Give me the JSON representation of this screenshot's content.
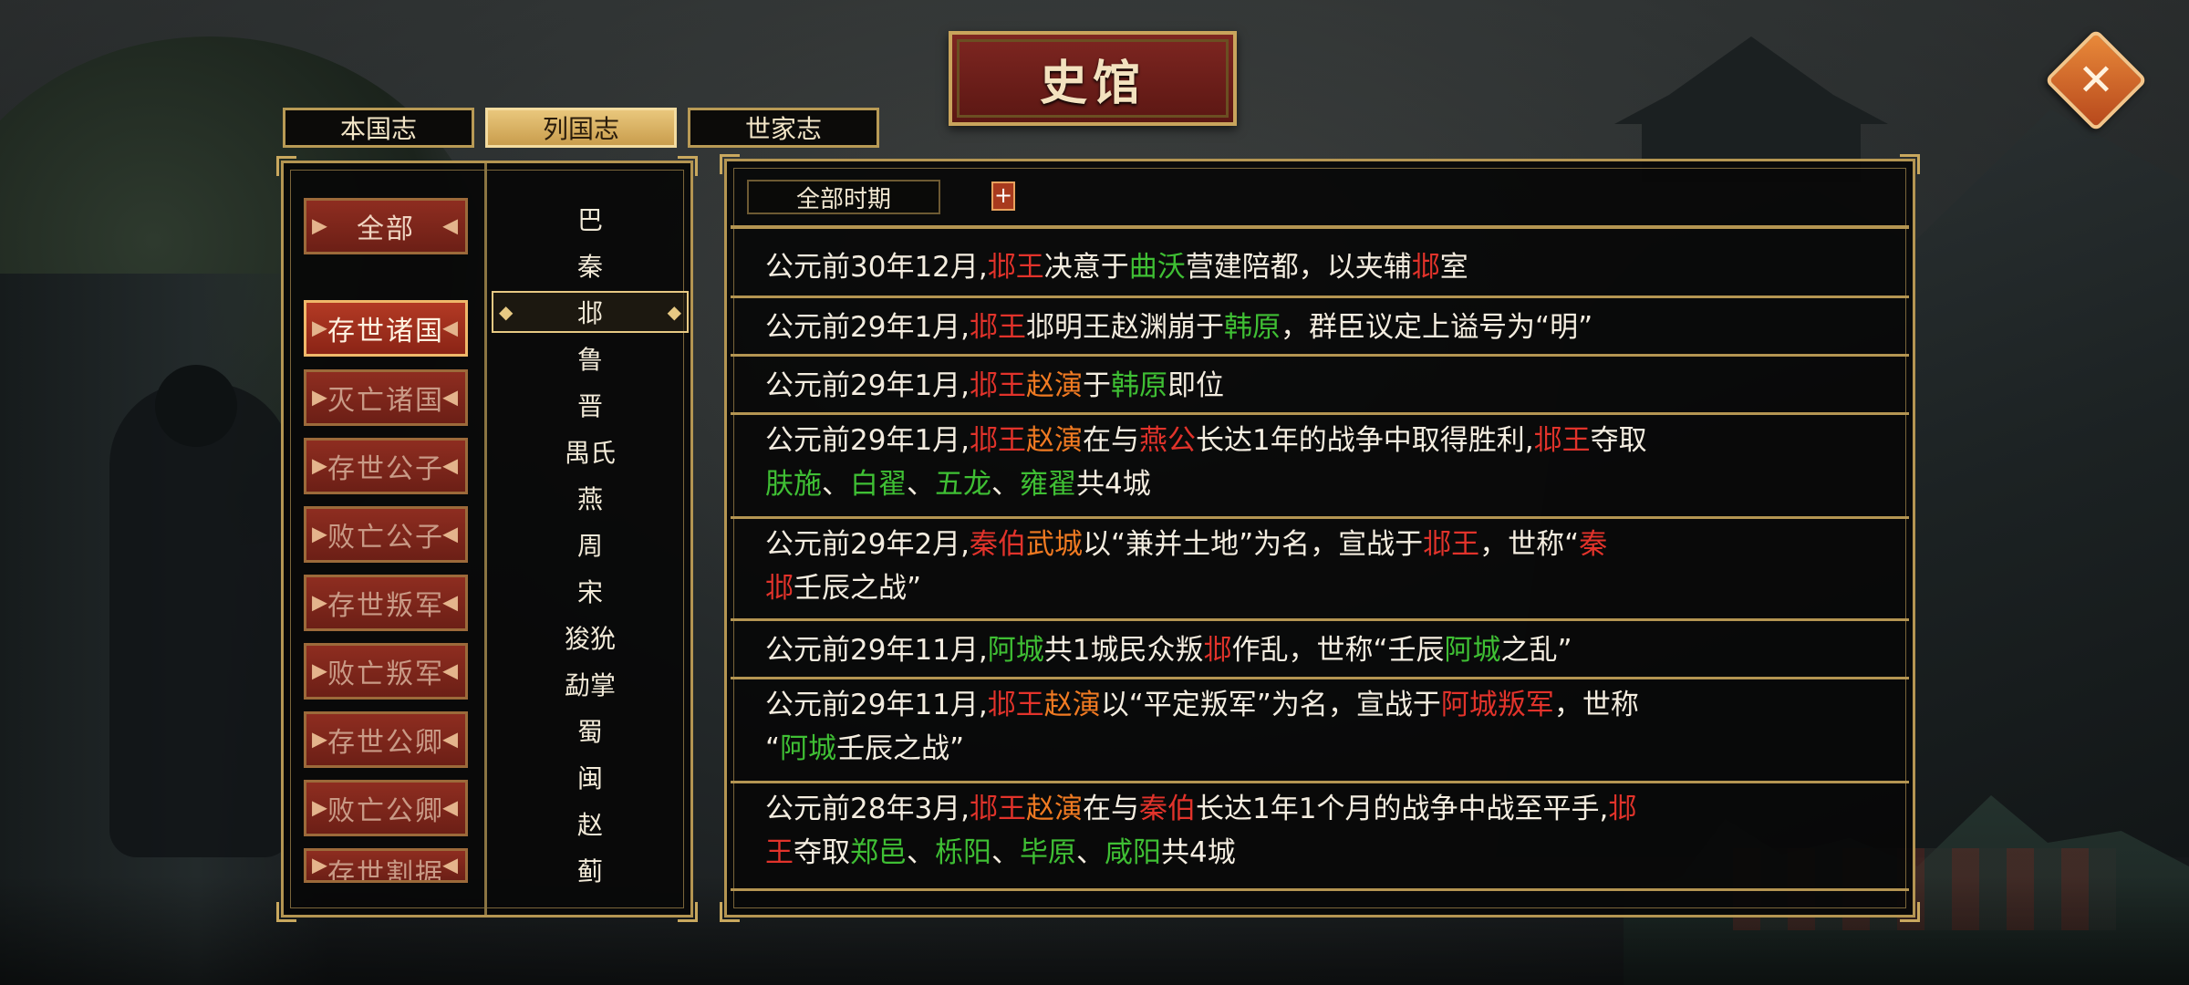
{
  "title": "史馆",
  "close": {
    "icon": "close-icon"
  },
  "tabs": [
    {
      "label": "本国志",
      "active": false
    },
    {
      "label": "列国志",
      "active": true
    },
    {
      "label": "世家志",
      "active": false
    }
  ],
  "categories": [
    {
      "label": "全部",
      "active": false
    },
    {
      "label": "存世诸国",
      "active": true
    },
    {
      "label": "灭亡诸国",
      "active": false
    },
    {
      "label": "存世公子",
      "active": false
    },
    {
      "label": "败亡公子",
      "active": false
    },
    {
      "label": "存世叛军",
      "active": false
    },
    {
      "label": "败亡叛军",
      "active": false
    },
    {
      "label": "存世公卿",
      "active": false
    },
    {
      "label": "败亡公卿",
      "active": false
    },
    {
      "label": "存世割据",
      "active": false
    }
  ],
  "nations": [
    "巴",
    "秦",
    "邶",
    "鲁",
    "晋",
    "禺氏",
    "燕",
    "周",
    "宋",
    "狻狁",
    "勐掌",
    "蜀",
    "闽",
    "赵",
    "蓟"
  ],
  "selected_nation": "邶",
  "filter": {
    "period": "全部时期",
    "add": "+"
  },
  "colors": {
    "red": "#e2332b",
    "green": "#3fbf34",
    "orange": "#f07a22",
    "gold": "#b49552"
  },
  "events": [
    {
      "segments": [
        [
          "公元前30年12月,",
          "w"
        ],
        [
          "邶王",
          "r"
        ],
        [
          "决意于",
          "w"
        ],
        [
          "曲沃",
          "g"
        ],
        [
          "营建陪都，以夹辅",
          "w"
        ],
        [
          "邶",
          "r"
        ],
        [
          "室",
          "w"
        ]
      ]
    },
    {
      "segments": [
        [
          "公元前29年1月,",
          "w"
        ],
        [
          "邶王",
          "r"
        ],
        [
          "邶明王赵渊崩于",
          "w"
        ],
        [
          "韩原",
          "g"
        ],
        [
          "，群臣议定上谥号为“明”",
          "w"
        ]
      ]
    },
    {
      "segments": [
        [
          "公元前29年1月,",
          "w"
        ],
        [
          "邶王",
          "r"
        ],
        [
          "赵演",
          "o"
        ],
        [
          "于",
          "w"
        ],
        [
          "韩原",
          "g"
        ],
        [
          "即位",
          "w"
        ]
      ]
    },
    {
      "segments": [
        [
          "公元前29年1月,",
          "w"
        ],
        [
          "邶王",
          "r"
        ],
        [
          "赵演",
          "o"
        ],
        [
          "在与",
          "w"
        ],
        [
          "燕公",
          "r"
        ],
        [
          "长达1年的战争中取得胜利,",
          "w"
        ],
        [
          "邶王",
          "r"
        ],
        [
          "夺取",
          "w"
        ],
        [
          "br",
          "br"
        ],
        [
          "肤施",
          "g"
        ],
        [
          "、",
          "w"
        ],
        [
          "白翟",
          "g"
        ],
        [
          "、",
          "w"
        ],
        [
          "五龙",
          "g"
        ],
        [
          "、",
          "w"
        ],
        [
          "雍翟",
          "g"
        ],
        [
          "共4城",
          "w"
        ]
      ]
    },
    {
      "segments": [
        [
          "公元前29年2月,",
          "w"
        ],
        [
          "秦伯",
          "r"
        ],
        [
          "武城",
          "o"
        ],
        [
          "以“兼并土地”为名，宣战于",
          "w"
        ],
        [
          "邶王",
          "r"
        ],
        [
          "，世称“",
          "w"
        ],
        [
          "秦",
          "r"
        ],
        [
          "br",
          "br"
        ],
        [
          "邶",
          "r"
        ],
        [
          "壬辰之战”",
          "w"
        ]
      ]
    },
    {
      "segments": [
        [
          "公元前29年11月,",
          "w"
        ],
        [
          "阿城",
          "g"
        ],
        [
          "共1城民众叛",
          "w"
        ],
        [
          "邶",
          "r"
        ],
        [
          "作乱，世称“壬辰",
          "w"
        ],
        [
          "阿城",
          "g"
        ],
        [
          "之乱”",
          "w"
        ]
      ]
    },
    {
      "segments": [
        [
          "公元前29年11月,",
          "w"
        ],
        [
          "邶王",
          "r"
        ],
        [
          "赵演",
          "o"
        ],
        [
          "以“平定叛军”为名，宣战于",
          "w"
        ],
        [
          "阿城叛军",
          "r"
        ],
        [
          "，世称",
          "w"
        ],
        [
          "br",
          "br"
        ],
        [
          "“",
          "w"
        ],
        [
          "阿城",
          "g"
        ],
        [
          "壬辰之战”",
          "w"
        ]
      ]
    },
    {
      "segments": [
        [
          "公元前28年3月,",
          "w"
        ],
        [
          "邶王",
          "r"
        ],
        [
          "赵演",
          "o"
        ],
        [
          "在与",
          "w"
        ],
        [
          "秦伯",
          "r"
        ],
        [
          "长达1年1个月的战争中战至平手,",
          "w"
        ],
        [
          "邶",
          "r"
        ],
        [
          "br",
          "br"
        ],
        [
          "王",
          "r"
        ],
        [
          "夺取",
          "w"
        ],
        [
          "郑邑",
          "g"
        ],
        [
          "、",
          "w"
        ],
        [
          "栎阳",
          "g"
        ],
        [
          "、",
          "w"
        ],
        [
          "毕原",
          "g"
        ],
        [
          "、",
          "w"
        ],
        [
          "咸阳",
          "g"
        ],
        [
          "共4城",
          "w"
        ]
      ]
    }
  ]
}
